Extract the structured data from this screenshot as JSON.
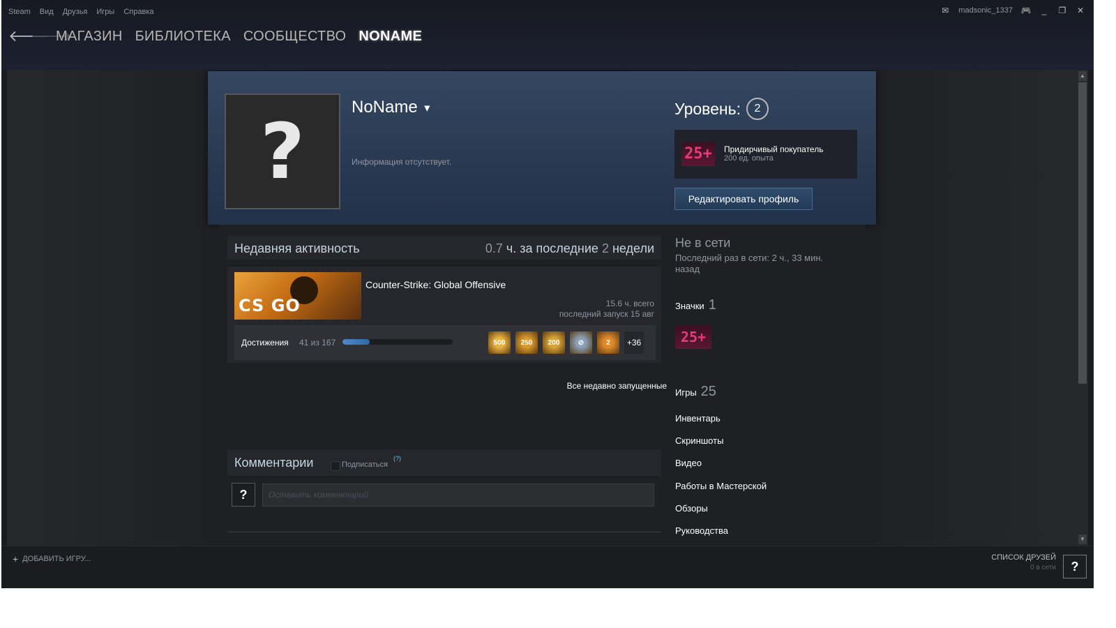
{
  "menu": [
    "Steam",
    "Вид",
    "Друзья",
    "Игры",
    "Справка"
  ],
  "account": {
    "username": "madsonic_1337"
  },
  "nav": {
    "back": "🡐",
    "forward": "🡒",
    "links": [
      "МАГАЗИН",
      "БИБЛИОТЕКА",
      "СООБЩЕСТВО",
      "NONAME"
    ],
    "active": "NONAME"
  },
  "profile": {
    "avatar_glyph": "?",
    "name": "NoName",
    "info": "Информация отсутствует.",
    "level_label": "Уровень:",
    "level": "2",
    "badge": {
      "icon_text": "25+",
      "name": "Придирчивый покупатель",
      "xp": "200 ед. опыта"
    },
    "edit_button": "Редактировать профиль"
  },
  "activity": {
    "title": "Недавняя активность",
    "hours_num": "0.7",
    "hours_unit": "ч. за последние",
    "weeks_num": "2",
    "weeks_unit": "недели",
    "game": {
      "logo": "CS GO",
      "name": "Counter-Strike: Global Offensive",
      "total": "15.6 ч. всего",
      "last": "последний запуск 15 авг"
    },
    "achievements": {
      "label": "Достижения",
      "count": "41 из 167",
      "progress": 0.245,
      "icons": [
        {
          "name": "500-achievement-icon",
          "text": "500",
          "color": "#e8b343"
        },
        {
          "name": "250-achievement-icon",
          "text": "250",
          "color": "#d99a2e"
        },
        {
          "name": "200-stars-achievement-icon",
          "text": "200",
          "color": "#d8a43a"
        },
        {
          "name": "no-weapon-achievement-icon",
          "text": "⊘",
          "color": "#8aa0b8"
        },
        {
          "name": "knife-2-achievement-icon",
          "text": "2",
          "color": "#e08a2a"
        }
      ],
      "more": "+36"
    },
    "all_recent": "Все недавно запущенные"
  },
  "comments": {
    "title": "Комментарии",
    "subscribe": "Подписаться",
    "help": "(?)",
    "avatar_glyph": "?",
    "placeholder": "Оставить комментарий"
  },
  "sidebar": {
    "status": "Не в сети",
    "last_online": "Последний раз в сети: 2 ч., 33 мин. назад",
    "badges_label": "Значки",
    "badges_count": "1",
    "badge_icon": "25+",
    "games_label": "Игры",
    "games_count": "25",
    "links": [
      "Инвентарь",
      "Скриншоты",
      "Видео",
      "Работы в Мастерской",
      "Обзоры",
      "Руководства"
    ]
  },
  "bottom": {
    "add_game": "ДОБАВИТЬ ИГРУ...",
    "add_plus": "+",
    "friends_label": "СПИСОК ДРУЗЕЙ",
    "friends_online": "0 в сети",
    "friends_avatar": "?"
  }
}
